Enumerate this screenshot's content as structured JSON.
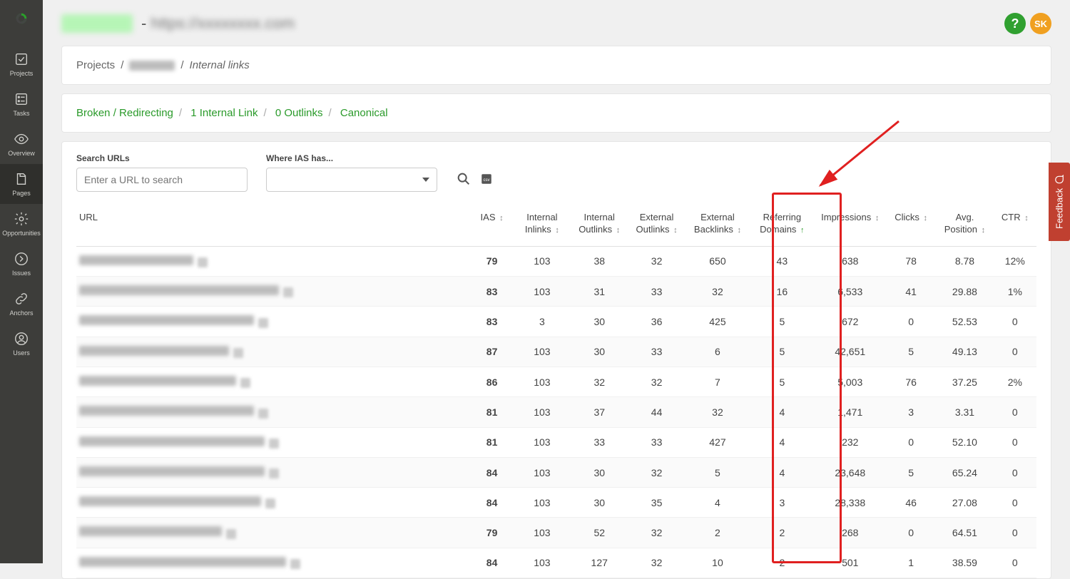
{
  "avatar_initials": "SK",
  "sidebar_items": [
    {
      "label": "Projects"
    },
    {
      "label": "Tasks"
    },
    {
      "label": "Overview"
    },
    {
      "label": "Pages"
    },
    {
      "label": "Opportunities"
    },
    {
      "label": "Issues"
    },
    {
      "label": "Anchors"
    },
    {
      "label": "Users"
    }
  ],
  "breadcrumb": {
    "root": "Projects",
    "current": "Internal links"
  },
  "tabs": [
    "Broken / Redirecting",
    "1 Internal Link",
    "0 Outlinks",
    "Canonical"
  ],
  "filters": {
    "search_label": "Search URLs",
    "search_placeholder": "Enter a URL to search",
    "where_label": "Where IAS has..."
  },
  "feedback_label": "Feedback",
  "columns": [
    "URL",
    "IAS",
    "Internal Inlinks",
    "Internal Outlinks",
    "External Outlinks",
    "External Backlinks",
    "Referring Domains",
    "Impressions",
    "Clicks",
    "Avg. Position",
    "CTR"
  ],
  "sorted_column": "Referring Domains",
  "rows": [
    {
      "ias": 79,
      "ias_cls": "ias-79",
      "url_w": 160,
      "in_in": "103",
      "in_out": "38",
      "ext_out": "32",
      "ext_back": "650",
      "ref": "43",
      "imp": "638",
      "clk": "78",
      "pos": "8.78",
      "ctr": "12%"
    },
    {
      "ias": 83,
      "ias_cls": "ias-green",
      "url_w": 280,
      "in_in": "103",
      "in_out": "31",
      "ext_out": "33",
      "ext_back": "32",
      "ref": "16",
      "imp": "6,533",
      "clk": "41",
      "pos": "29.88",
      "ctr": "1%"
    },
    {
      "ias": 83,
      "ias_cls": "ias-green",
      "url_w": 245,
      "in_in": "3",
      "in_out": "30",
      "ext_out": "36",
      "ext_back": "425",
      "ref": "5",
      "imp": "672",
      "clk": "0",
      "pos": "52.53",
      "ctr": "0"
    },
    {
      "ias": 87,
      "ias_cls": "ias-green",
      "url_w": 210,
      "in_in": "103",
      "in_out": "30",
      "ext_out": "33",
      "ext_back": "6",
      "ref": "5",
      "imp": "42,651",
      "clk": "5",
      "pos": "49.13",
      "ctr": "0"
    },
    {
      "ias": 86,
      "ias_cls": "ias-green",
      "url_w": 220,
      "in_in": "103",
      "in_out": "32",
      "ext_out": "32",
      "ext_back": "7",
      "ref": "5",
      "imp": "5,003",
      "clk": "76",
      "pos": "37.25",
      "ctr": "2%"
    },
    {
      "ias": 81,
      "ias_cls": "ias-green",
      "url_w": 245,
      "in_in": "103",
      "in_out": "37",
      "ext_out": "44",
      "ext_back": "32",
      "ref": "4",
      "imp": "1,471",
      "clk": "3",
      "pos": "3.31",
      "ctr": "0"
    },
    {
      "ias": 81,
      "ias_cls": "ias-green",
      "url_w": 260,
      "in_in": "103",
      "in_out": "33",
      "ext_out": "33",
      "ext_back": "427",
      "ref": "4",
      "imp": "232",
      "clk": "0",
      "pos": "52.10",
      "ctr": "0"
    },
    {
      "ias": 84,
      "ias_cls": "ias-green",
      "url_w": 260,
      "in_in": "103",
      "in_out": "30",
      "ext_out": "32",
      "ext_back": "5",
      "ref": "4",
      "imp": "23,648",
      "clk": "5",
      "pos": "65.24",
      "ctr": "0"
    },
    {
      "ias": 84,
      "ias_cls": "ias-green",
      "url_w": 255,
      "in_in": "103",
      "in_out": "30",
      "ext_out": "35",
      "ext_back": "4",
      "ref": "3",
      "imp": "28,338",
      "clk": "46",
      "pos": "27.08",
      "ctr": "0"
    },
    {
      "ias": 79,
      "ias_cls": "ias-79",
      "url_w": 200,
      "in_in": "103",
      "in_out": "52",
      "ext_out": "32",
      "ext_back": "2",
      "ref": "2",
      "imp": "268",
      "clk": "0",
      "pos": "64.51",
      "ctr": "0"
    },
    {
      "ias": 84,
      "ias_cls": "ias-green",
      "url_w": 290,
      "in_in": "103",
      "in_out": "127",
      "ext_out": "32",
      "ext_back": "10",
      "ref": "2",
      "imp": "501",
      "clk": "1",
      "pos": "38.59",
      "ctr": "0"
    }
  ]
}
